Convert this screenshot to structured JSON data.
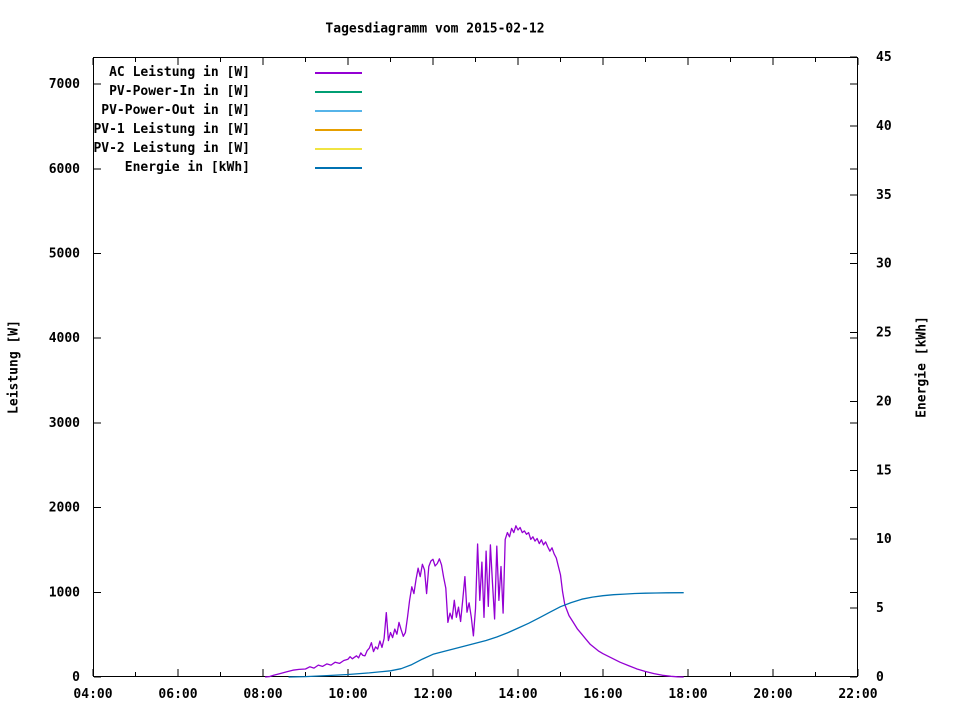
{
  "title": "Tagesdiagramm vom 2015-02-12",
  "legend": {
    "entries": [
      {
        "label": "AC Leistung in [W]",
        "color": "#9400d3"
      },
      {
        "label": "PV-Power-In in [W]",
        "color": "#009e73"
      },
      {
        "label": "PV-Power-Out in [W]",
        "color": "#56b4e9"
      },
      {
        "label": "PV-1 Leistung in [W]",
        "color": "#e69f00"
      },
      {
        "label": "PV-2 Leistung in [W]",
        "color": "#f0e442"
      },
      {
        "label": "Energie in [kWh]",
        "color": "#0072b2"
      }
    ]
  },
  "axes": {
    "left": {
      "label": "Leistung [W]",
      "tick_values": [
        0,
        1000,
        2000,
        3000,
        4000,
        5000,
        6000,
        7000
      ],
      "range": [
        0,
        7320
      ]
    },
    "right": {
      "label": "Energie [kWh]",
      "tick_values": [
        0,
        5,
        10,
        15,
        20,
        25,
        30,
        35,
        40,
        45
      ],
      "range": [
        0,
        45
      ]
    },
    "x": {
      "major_ticks": [
        {
          "label": "04:00",
          "hour": 4
        },
        {
          "label": "06:00",
          "hour": 6
        },
        {
          "label": "08:00",
          "hour": 8
        },
        {
          "label": "10:00",
          "hour": 10
        },
        {
          "label": "12:00",
          "hour": 12
        },
        {
          "label": "14:00",
          "hour": 14
        },
        {
          "label": "16:00",
          "hour": 16
        },
        {
          "label": "18:00",
          "hour": 18
        },
        {
          "label": "20:00",
          "hour": 20
        },
        {
          "label": "22:00",
          "hour": 22
        }
      ],
      "minor_hours": [
        5,
        7,
        9,
        11,
        13,
        15,
        17,
        19,
        21
      ],
      "range_hours": [
        4,
        22
      ]
    }
  },
  "chart_data": {
    "type": "line",
    "title": "Tagesdiagramm vom 2015-02-12",
    "xlabel": "",
    "x_unit": "hour_of_day",
    "xlim": [
      "04:00",
      "22:00"
    ],
    "ylabel_left": "Leistung [W]",
    "ylabel_right": "Energie [kWh]",
    "ylim_left": [
      0,
      7000
    ],
    "ylim_right": [
      0,
      45
    ],
    "grid": false,
    "legend_position": "top-left-inside",
    "series": [
      {
        "name": "AC Leistung in [W]",
        "color": "#9400d3",
        "axis": "left",
        "points": [
          [
            8.05,
            0
          ],
          [
            8.15,
            5
          ],
          [
            8.25,
            20
          ],
          [
            8.4,
            40
          ],
          [
            8.55,
            60
          ],
          [
            8.7,
            80
          ],
          [
            8.85,
            90
          ],
          [
            9.0,
            95
          ],
          [
            9.1,
            120
          ],
          [
            9.2,
            105
          ],
          [
            9.3,
            140
          ],
          [
            9.4,
            125
          ],
          [
            9.5,
            155
          ],
          [
            9.6,
            140
          ],
          [
            9.7,
            175
          ],
          [
            9.8,
            160
          ],
          [
            9.9,
            195
          ],
          [
            10.0,
            210
          ],
          [
            10.05,
            240
          ],
          [
            10.1,
            215
          ],
          [
            10.2,
            250
          ],
          [
            10.25,
            225
          ],
          [
            10.3,
            285
          ],
          [
            10.35,
            255
          ],
          [
            10.4,
            250
          ],
          [
            10.45,
            310
          ],
          [
            10.5,
            340
          ],
          [
            10.55,
            405
          ],
          [
            10.6,
            300
          ],
          [
            10.65,
            355
          ],
          [
            10.7,
            330
          ],
          [
            10.75,
            425
          ],
          [
            10.8,
            350
          ],
          [
            10.85,
            455
          ],
          [
            10.9,
            760
          ],
          [
            10.95,
            430
          ],
          [
            11.0,
            525
          ],
          [
            11.05,
            465
          ],
          [
            11.1,
            565
          ],
          [
            11.15,
            505
          ],
          [
            11.2,
            645
          ],
          [
            11.25,
            560
          ],
          [
            11.3,
            480
          ],
          [
            11.35,
            525
          ],
          [
            11.4,
            705
          ],
          [
            11.45,
            905
          ],
          [
            11.5,
            1065
          ],
          [
            11.55,
            985
          ],
          [
            11.6,
            1150
          ],
          [
            11.65,
            1285
          ],
          [
            11.7,
            1185
          ],
          [
            11.75,
            1330
          ],
          [
            11.8,
            1265
          ],
          [
            11.85,
            985
          ],
          [
            11.9,
            1305
          ],
          [
            11.95,
            1370
          ],
          [
            12.0,
            1390
          ],
          [
            12.05,
            1310
          ],
          [
            12.1,
            1340
          ],
          [
            12.15,
            1395
          ],
          [
            12.2,
            1325
          ],
          [
            12.25,
            1180
          ],
          [
            12.3,
            1050
          ],
          [
            12.35,
            645
          ],
          [
            12.4,
            755
          ],
          [
            12.45,
            685
          ],
          [
            12.5,
            905
          ],
          [
            12.55,
            705
          ],
          [
            12.6,
            825
          ],
          [
            12.65,
            655
          ],
          [
            12.7,
            905
          ],
          [
            12.75,
            1185
          ],
          [
            12.8,
            765
          ],
          [
            12.85,
            875
          ],
          [
            12.9,
            705
          ],
          [
            12.95,
            485
          ],
          [
            13.0,
            805
          ],
          [
            13.05,
            1570
          ],
          [
            13.1,
            905
          ],
          [
            13.15,
            1355
          ],
          [
            13.2,
            705
          ],
          [
            13.25,
            1485
          ],
          [
            13.3,
            835
          ],
          [
            13.35,
            1560
          ],
          [
            13.4,
            1105
          ],
          [
            13.45,
            685
          ],
          [
            13.5,
            1545
          ],
          [
            13.55,
            905
          ],
          [
            13.6,
            1305
          ],
          [
            13.65,
            755
          ],
          [
            13.7,
            1625
          ],
          [
            13.75,
            1705
          ],
          [
            13.8,
            1655
          ],
          [
            13.85,
            1755
          ],
          [
            13.9,
            1705
          ],
          [
            13.95,
            1785
          ],
          [
            14.0,
            1735
          ],
          [
            14.05,
            1765
          ],
          [
            14.1,
            1705
          ],
          [
            14.15,
            1725
          ],
          [
            14.2,
            1685
          ],
          [
            14.25,
            1705
          ],
          [
            14.3,
            1625
          ],
          [
            14.35,
            1655
          ],
          [
            14.4,
            1605
          ],
          [
            14.45,
            1635
          ],
          [
            14.5,
            1575
          ],
          [
            14.55,
            1620
          ],
          [
            14.6,
            1560
          ],
          [
            14.65,
            1595
          ],
          [
            14.7,
            1535
          ],
          [
            14.75,
            1485
          ],
          [
            14.8,
            1525
          ],
          [
            14.85,
            1455
          ],
          [
            14.9,
            1405
          ],
          [
            14.95,
            1305
          ],
          [
            15.0,
            1205
          ],
          [
            15.05,
            1005
          ],
          [
            15.1,
            855
          ],
          [
            15.2,
            725
          ],
          [
            15.3,
            645
          ],
          [
            15.4,
            565
          ],
          [
            15.5,
            505
          ],
          [
            15.6,
            445
          ],
          [
            15.7,
            385
          ],
          [
            15.8,
            345
          ],
          [
            15.9,
            305
          ],
          [
            16.0,
            275
          ],
          [
            16.2,
            225
          ],
          [
            16.4,
            175
          ],
          [
            16.6,
            135
          ],
          [
            16.8,
            95
          ],
          [
            17.0,
            65
          ],
          [
            17.2,
            40
          ],
          [
            17.4,
            20
          ],
          [
            17.6,
            8
          ],
          [
            17.75,
            2
          ],
          [
            17.9,
            0
          ]
        ]
      },
      {
        "name": "PV-Power-In in [W]",
        "color": "#009e73",
        "axis": "left",
        "points": []
      },
      {
        "name": "PV-Power-Out in [W]",
        "color": "#56b4e9",
        "axis": "left",
        "points": []
      },
      {
        "name": "PV-1 Leistung in [W]",
        "color": "#e69f00",
        "axis": "left",
        "points": []
      },
      {
        "name": "PV-2 Leistung in [W]",
        "color": "#f0e442",
        "axis": "left",
        "points": []
      },
      {
        "name": "Energie in [kWh]",
        "color": "#0072b2",
        "axis": "right",
        "points": [
          [
            8.6,
            0
          ],
          [
            9.0,
            0.03
          ],
          [
            9.5,
            0.1
          ],
          [
            10.0,
            0.18
          ],
          [
            10.5,
            0.3
          ],
          [
            11.0,
            0.45
          ],
          [
            11.25,
            0.6
          ],
          [
            11.5,
            0.9
          ],
          [
            11.75,
            1.3
          ],
          [
            12.0,
            1.65
          ],
          [
            12.25,
            1.85
          ],
          [
            12.5,
            2.05
          ],
          [
            12.75,
            2.25
          ],
          [
            13.0,
            2.45
          ],
          [
            13.25,
            2.65
          ],
          [
            13.5,
            2.9
          ],
          [
            13.75,
            3.2
          ],
          [
            14.0,
            3.55
          ],
          [
            14.25,
            3.9
          ],
          [
            14.5,
            4.3
          ],
          [
            14.75,
            4.7
          ],
          [
            15.0,
            5.1
          ],
          [
            15.25,
            5.4
          ],
          [
            15.5,
            5.65
          ],
          [
            15.75,
            5.8
          ],
          [
            16.0,
            5.9
          ],
          [
            16.25,
            5.97
          ],
          [
            16.5,
            6.02
          ],
          [
            16.75,
            6.06
          ],
          [
            17.0,
            6.08
          ],
          [
            17.25,
            6.1
          ],
          [
            17.5,
            6.11
          ],
          [
            17.9,
            6.12
          ]
        ]
      }
    ]
  }
}
